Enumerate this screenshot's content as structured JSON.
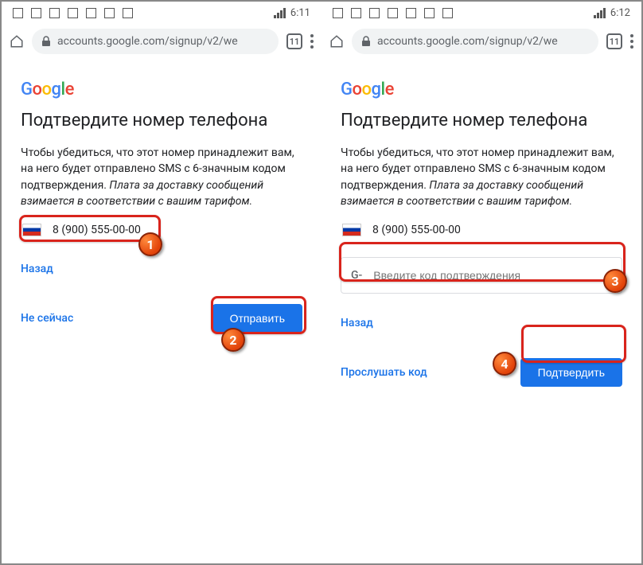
{
  "left_screen": {
    "status": {
      "time": "6:11"
    },
    "chrome": {
      "url": "accounts.google.com/signup/v2/we",
      "tab_count": "11"
    },
    "page": {
      "heading": "Подтвердите номер телефона",
      "desc_plain": "Чтобы убедиться, что этот номер принадлежит вам, на него будет отправлено SMS с 6-значным кодом подтверждения. ",
      "desc_italic": "Плата за доставку сообщений взимается в соответствии с вашим тарифом.",
      "phone": "8 (900) 555-00-00",
      "back_link": "Назад",
      "not_now_link": "Не сейчас",
      "submit_btn": "Отправить"
    }
  },
  "right_screen": {
    "status": {
      "time": "6:12"
    },
    "chrome": {
      "url": "accounts.google.com/signup/v2/we",
      "tab_count": "11"
    },
    "page": {
      "heading": "Подтвердите номер телефона",
      "desc_plain": "Чтобы убедиться, что этот номер принадлежит вам, на него будет отправлено SMS с 6-значным кодом подтверждения. ",
      "desc_italic": "Плата за доставку сообщений взимается в соответствии с вашим тарифом.",
      "phone": "8 (900) 555-00-00",
      "code_prefix": "G-",
      "code_placeholder": "Введите код подтверждения",
      "back_link": "Назад",
      "listen_link": "Прослушать код",
      "confirm_btn": "Подтвердить"
    }
  },
  "markers": {
    "m1": "1",
    "m2": "2",
    "m3": "3",
    "m4": "4"
  }
}
